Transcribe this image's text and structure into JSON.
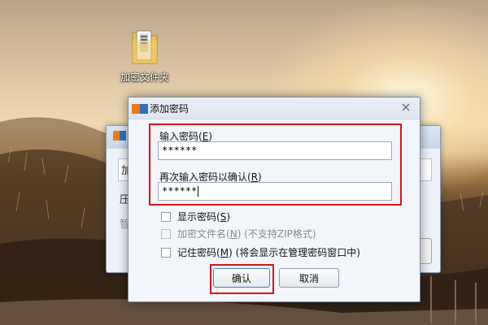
{
  "desktop": {
    "icon_label": "加密文件夹"
  },
  "background_window": {
    "fragments": [
      "加",
      "压",
      "智"
    ]
  },
  "dialog": {
    "title": "添加密码",
    "password_label": "输入密码",
    "password_key": "E",
    "password_value": "******",
    "confirm_label": "再次输入密码以确认",
    "confirm_key": "R",
    "confirm_value": "******",
    "options": [
      {
        "label": "显示密码",
        "key": "S",
        "suffix": "",
        "checked": false,
        "enabled": true
      },
      {
        "label": "加密文件名",
        "key": "N",
        "suffix": " (不支持ZIP格式)",
        "checked": false,
        "enabled": false
      },
      {
        "label": "记住密码",
        "key": "M",
        "suffix": " (将会显示在管理密码窗口中)",
        "checked": false,
        "enabled": true
      }
    ],
    "ok_label": "确认",
    "cancel_label": "取消"
  },
  "colors": {
    "highlight_red": "#d9141d",
    "dialog_bg": "#f2f5fa",
    "logo_orange": "#f07a12",
    "logo_blue": "#2f6fbf"
  }
}
